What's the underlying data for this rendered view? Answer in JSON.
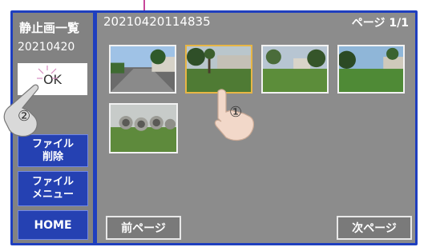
{
  "sidebar": {
    "title": "静止画一覧",
    "date": "20210420",
    "ok_label": "OK",
    "buttons": [
      {
        "line1": "ファイル",
        "line2": "削除"
      },
      {
        "line1": "ファイル",
        "line2": "メニュー"
      },
      {
        "line1": "HOME",
        "line2": ""
      }
    ]
  },
  "main": {
    "timestamp": "20210420114835",
    "page_indicator": "ページ 1/1",
    "prev_label": "前ページ",
    "next_label": "次ページ"
  },
  "annotations": {
    "step1": "①",
    "step2": "②"
  },
  "colors": {
    "frame": "#1f3fbf",
    "button": "#2541b2",
    "selected": "#e8b645",
    "pointer": "#c8489a"
  }
}
